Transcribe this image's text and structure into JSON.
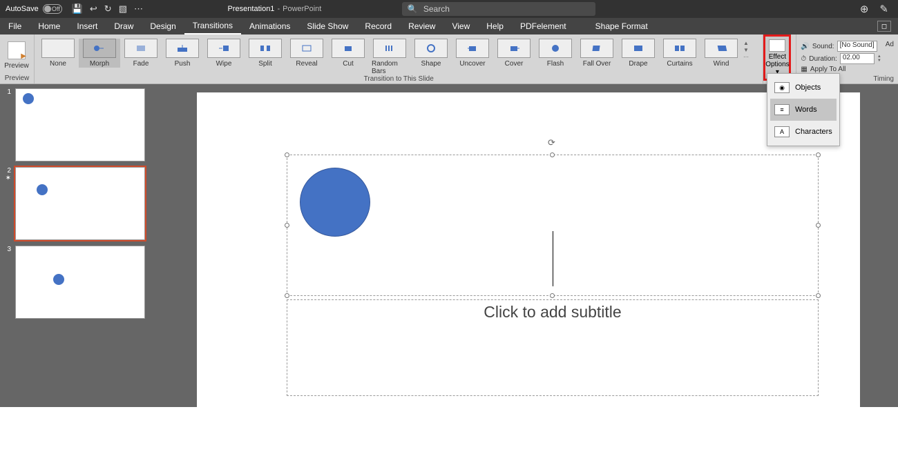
{
  "titlebar": {
    "autosave_label": "AutoSave",
    "toggle_text": "Off",
    "doc_name": "Presentation1",
    "app_name": "PowerPoint",
    "search_placeholder": "Search"
  },
  "tabs": {
    "file": "File",
    "home": "Home",
    "insert": "Insert",
    "draw": "Draw",
    "design": "Design",
    "transitions": "Transitions",
    "animations": "Animations",
    "slideshow": "Slide Show",
    "record": "Record",
    "review": "Review",
    "view": "View",
    "help": "Help",
    "pdfelement": "PDFelement",
    "shapeformat": "Shape Format"
  },
  "ribbon": {
    "preview": "Preview",
    "preview_group": "Preview",
    "transitions_group": "Transition to This Slide",
    "timing_group": "Timing",
    "effect_options": "Effect Options ▾",
    "trans": {
      "none": "None",
      "morph": "Morph",
      "fade": "Fade",
      "push": "Push",
      "wipe": "Wipe",
      "split": "Split",
      "reveal": "Reveal",
      "cut": "Cut",
      "randombars": "Random Bars",
      "shape": "Shape",
      "uncover": "Uncover",
      "cover": "Cover",
      "flash": "Flash",
      "fallover": "Fall Over",
      "drape": "Drape",
      "curtains": "Curtains",
      "wind": "Wind"
    },
    "sound_label": "Sound:",
    "sound_value": "[No Sound]",
    "duration_label": "Duration:",
    "duration_value": "02.00",
    "apply_all": "Apply To All",
    "advance": "Ad"
  },
  "dropdown": {
    "objects": "Objects",
    "words": "Words",
    "characters": "Characters"
  },
  "slides": {
    "n1": "1",
    "n2": "2",
    "n3": "3"
  },
  "canvas": {
    "subtitle": "Click to add subtitle"
  }
}
